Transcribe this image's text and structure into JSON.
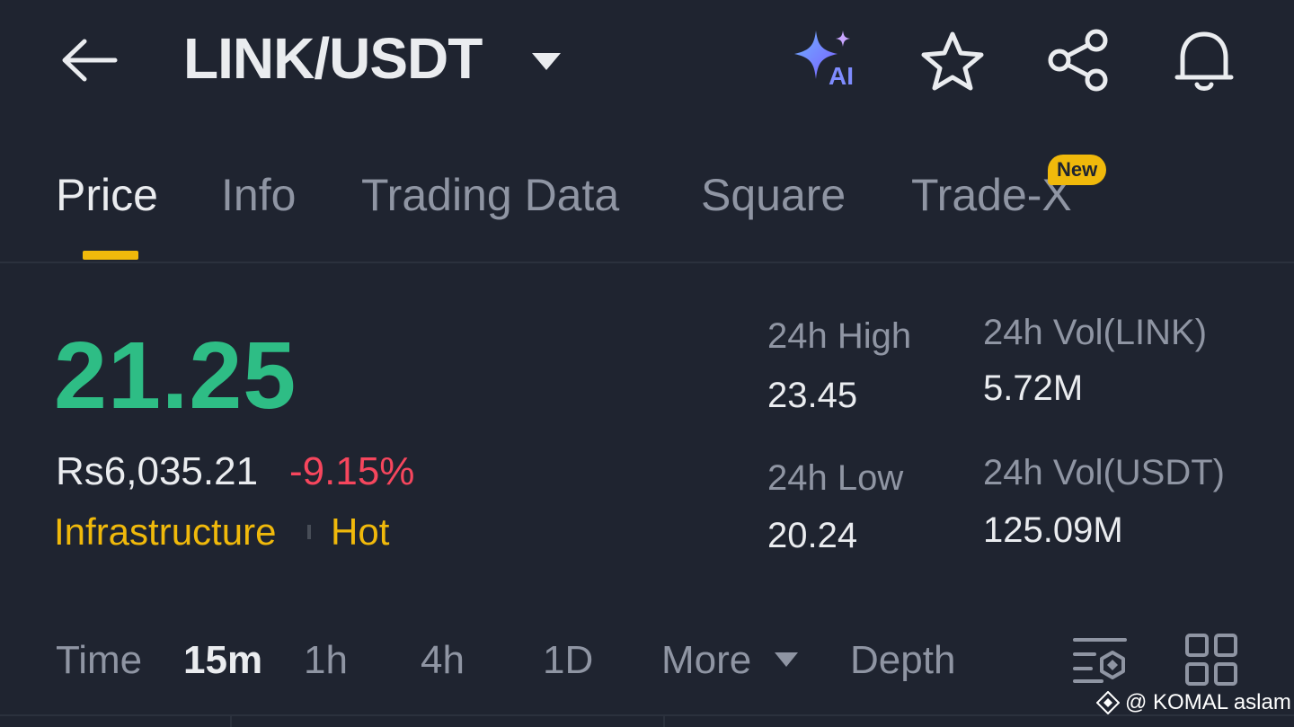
{
  "header": {
    "pair": "LINK/USDT",
    "ai_label": "AI"
  },
  "tabs": [
    {
      "label": "Price",
      "active": true
    },
    {
      "label": "Info"
    },
    {
      "label": "Trading Data"
    },
    {
      "label": "Square"
    },
    {
      "label": "Trade-X",
      "badge": "New"
    }
  ],
  "ticker": {
    "last_price": "21.25",
    "fiat_price": "Rs6,035.21",
    "change_pct": "-9.15%",
    "tags": [
      "Infrastructure",
      "Hot"
    ]
  },
  "stats": {
    "high_label": "24h High",
    "high_value": "23.45",
    "low_label": "24h Low",
    "low_value": "20.24",
    "vol_base_label": "24h Vol(LINK)",
    "vol_base_value": "5.72M",
    "vol_quote_label": "24h Vol(USDT)",
    "vol_quote_value": "125.09M"
  },
  "intervals": {
    "items": [
      "Time",
      "15m",
      "1h",
      "4h",
      "1D",
      "More",
      "Depth"
    ],
    "active": "15m"
  },
  "watermark": "@ KOMAL aslam",
  "colors": {
    "background": "#1f2430",
    "up_green": "#2ebd85",
    "down_red": "#f6465d",
    "accent_yellow": "#f0b90b",
    "muted_text": "#8f95a3",
    "primary_text": "#eaecef"
  }
}
